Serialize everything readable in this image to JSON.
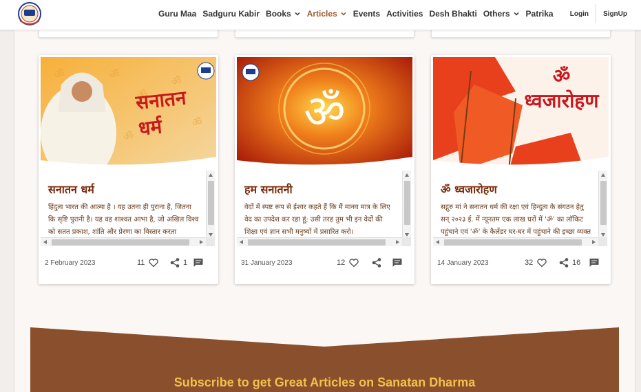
{
  "header": {
    "logo_name": "gyan-logo",
    "nav": [
      {
        "label": "Guru Maa",
        "dropdown": false,
        "active": false
      },
      {
        "label": "Sadguru Kabir",
        "dropdown": false,
        "active": false
      },
      {
        "label": "Books",
        "dropdown": true,
        "active": false
      },
      {
        "label": "Articles",
        "dropdown": true,
        "active": true
      },
      {
        "label": "Events",
        "dropdown": false,
        "active": false
      },
      {
        "label": "Activities",
        "dropdown": false,
        "active": false
      },
      {
        "label": "Desh Bhakti",
        "dropdown": false,
        "active": false
      },
      {
        "label": "Others",
        "dropdown": true,
        "active": false
      },
      {
        "label": "Patrika",
        "dropdown": false,
        "active": false
      }
    ],
    "login_label": "Login",
    "signup_label": "SignUp"
  },
  "cards": [
    {
      "image_title": "सनातन धर्म",
      "title": "सनातन धर्म",
      "text": "हिंदुत्व भारत की आत्मा है । यह उतना ही पुराना है, जितना कि सृष्टि पुरानी है। यह वह शाश्वत आभा है, जो अखिल विश्व को सतत प्रकाश, शांति और प्रेरणा का विस्तार करता",
      "date": "2 February 2023",
      "likes": "11",
      "shares": "1",
      "comments": ""
    },
    {
      "image_title": "ॐ",
      "title": "हम सनातनी",
      "text": "वेदों में स्पष्ट रूप से ईश्वर कहते हैं कि मैं मानव मात्र के लिए वेद का उपदेश कर रहा हूं; उसी तरह तुम भी इन वेदों की शिक्षा एवं ज्ञान सभी मनुष्यों में प्रसारित करो।",
      "date": "31 January 2023",
      "likes": "12",
      "shares": "",
      "comments": ""
    },
    {
      "image_title": "ॐ ध्वजारोहण",
      "title": "ॐ ध्वजारोहण",
      "text": "सद्गुरु मां ने सनातन धर्म की रक्षा एवं हिन्दुत्व के संगठन हेतु सन् २०२३ ई. में न्यूनतम एक लाख घरों में 'ॐ' का लॉकिट पहुंचाने एवं 'ॐ' के कैलेंडर घर-घर में पहुंचाने की इच्छा व्यक्त की",
      "date": "14 January 2023",
      "likes": "32",
      "shares": "16",
      "comments": ""
    }
  ],
  "subscribe": {
    "text": "Subscribe to get Great Articles on Sanatan Dharma"
  },
  "colors": {
    "accent": "#9a5a2f",
    "band": "#8a4f2c",
    "subscribe_text": "#f3c04a",
    "title": "#7a2a0a"
  }
}
